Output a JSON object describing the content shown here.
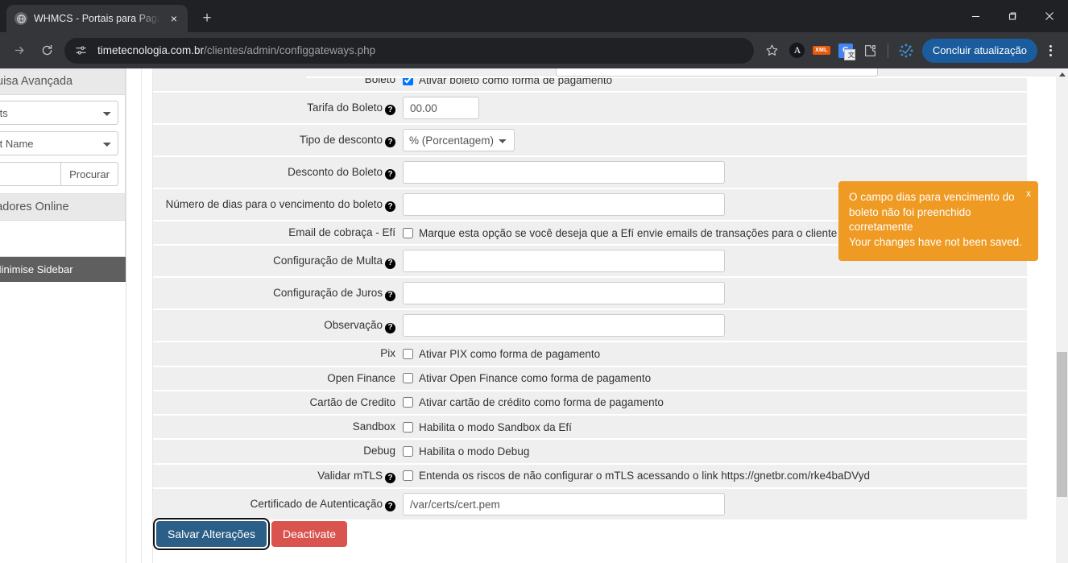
{
  "browser": {
    "tab": {
      "title": "WHMCS - Portais para Pagame",
      "favicon": "globe-icon",
      "close": "×"
    },
    "new_tab": "+",
    "window_controls": {
      "minimize": "—",
      "maximize": "❐",
      "close": "✕"
    },
    "nav": {
      "forward": "→",
      "reload": "↻"
    },
    "omnibox": {
      "icon": "site-settings-icon",
      "url_domain": "timetecnologia.com.br",
      "url_path": "/clientes/admin/configgateways.php",
      "star": "bookmark-star-icon"
    },
    "extensions": [
      {
        "name": "a-badge-icon",
        "label": "A"
      },
      {
        "name": "xml-badge-icon",
        "label": "XML"
      },
      {
        "name": "google-translate-icon",
        "label": "G"
      },
      {
        "name": "extensions-puzzle-icon",
        "label": ""
      },
      {
        "name": "sync-dots-icon",
        "label": ""
      }
    ],
    "profile_button": "Concluir atualização",
    "menu_button": "chrome-menu-icon"
  },
  "sidebar": {
    "advanced_search": {
      "title": "Pesquisa Avançada",
      "select_type": "Clients",
      "select_field": "Client Name",
      "search_value": "",
      "search_placeholder": "",
      "search_button": "Procurar"
    },
    "operators_online": {
      "title": "Operadores Online"
    },
    "minimise": "« Minimise Sidebar"
  },
  "toast": {
    "line1": "O campo dias para vencimento do boleto não foi preenchido corretamente",
    "line2": "Your changes have not been saved.",
    "close": "x",
    "color": "#ef9a22"
  },
  "form": {
    "rows": [
      {
        "label": "Boleto",
        "help": false,
        "type": "checkbox",
        "checked": true,
        "text": "Ativar boleto como forma de pagamento"
      },
      {
        "label": "Tarifa do Boleto",
        "help": true,
        "type": "text",
        "value": "00.00",
        "width": "w95"
      },
      {
        "label": "Tipo de desconto",
        "help": true,
        "type": "select",
        "value": "% (Porcentagem)"
      },
      {
        "label": "Desconto do Boleto",
        "help": true,
        "type": "text",
        "value": "",
        "width": "w400"
      },
      {
        "label": "Número de dias para o vencimento do boleto",
        "help": true,
        "type": "text",
        "value": "",
        "width": "w400"
      },
      {
        "label": "Email de cobraça - Efí",
        "help": false,
        "type": "checkbox",
        "checked": false,
        "text": "Marque esta opção se você deseja que a Efí envie emails de transações para o cliente final"
      },
      {
        "label": "Configuração de Multa",
        "help": true,
        "type": "text",
        "value": "",
        "width": "w400"
      },
      {
        "label": "Configuração de Juros",
        "help": true,
        "type": "text",
        "value": "",
        "width": "w400"
      },
      {
        "label": "Observação",
        "help": true,
        "type": "text",
        "value": "",
        "width": "w400"
      },
      {
        "label": "Pix",
        "help": false,
        "type": "checkbox",
        "checked": false,
        "text": "Ativar PIX como forma de pagamento"
      },
      {
        "label": "Open Finance",
        "help": false,
        "type": "checkbox",
        "checked": false,
        "text": "Ativar Open Finance como forma de pagamento"
      },
      {
        "label": "Cartão de Credito",
        "help": false,
        "type": "checkbox",
        "checked": false,
        "text": "Ativar cartão de crédito como forma de pagamento"
      },
      {
        "label": "Sandbox",
        "help": false,
        "type": "checkbox",
        "checked": false,
        "text": "Habilita o modo Sandbox da Efí"
      },
      {
        "label": "Debug",
        "help": false,
        "type": "checkbox",
        "checked": false,
        "text": "Habilita o modo Debug"
      },
      {
        "label": "Validar mTLS",
        "help": true,
        "type": "checkbox",
        "checked": false,
        "text": "Entenda os riscos de não configurar o mTLS acessando o link https://gnetbr.com/rke4baDVyd"
      },
      {
        "label": "Certificado de Autenticação",
        "help": true,
        "type": "text",
        "value": "/var/certs/cert.pem",
        "width": "w400"
      }
    ],
    "buttons": {
      "save": "Salvar Alterações",
      "deactivate": "Deactivate"
    },
    "help_glyph": "?"
  },
  "scrollbar": {
    "up_arrow": "▲"
  }
}
